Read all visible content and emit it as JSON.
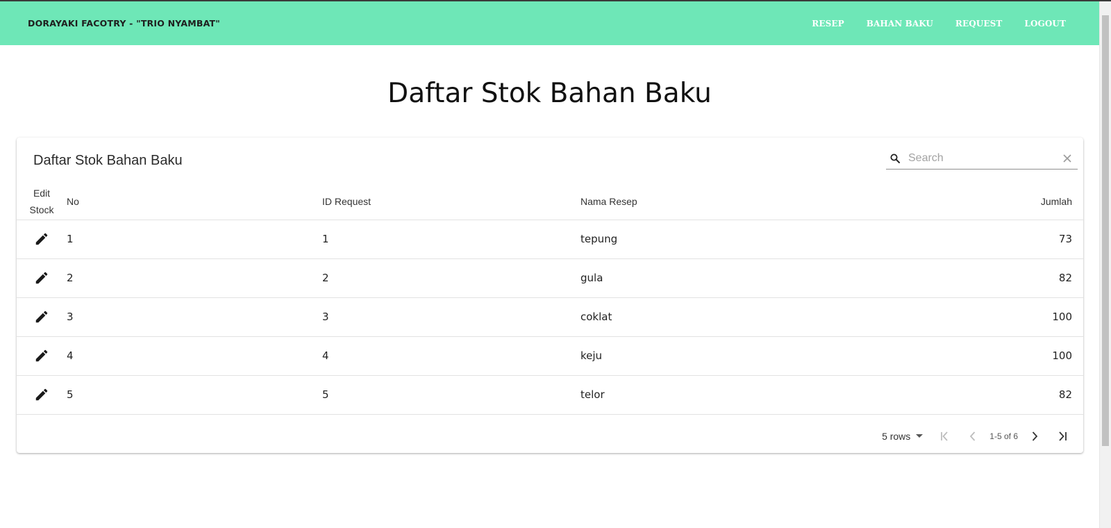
{
  "navbar": {
    "brand": "DORAYAKI FACOTRY - \"TRIO NYAMBAT\"",
    "links": [
      "RESEP",
      "BAHAN BAKU",
      "REQUEST",
      "LOGOUT"
    ]
  },
  "page_title": "Daftar Stok Bahan Baku",
  "card": {
    "title": "Daftar Stok Bahan Baku",
    "search_placeholder": "Search",
    "search_value": ""
  },
  "table": {
    "headers": {
      "edit_line1": "Edit",
      "edit_line2": "Stock",
      "no": "No",
      "id_request": "ID Request",
      "nama_resep": "Nama Resep",
      "jumlah": "Jumlah"
    },
    "rows": [
      {
        "no": "1",
        "id_request": "1",
        "nama_resep": "tepung",
        "jumlah": "73"
      },
      {
        "no": "2",
        "id_request": "2",
        "nama_resep": "gula",
        "jumlah": "82"
      },
      {
        "no": "3",
        "id_request": "3",
        "nama_resep": "coklat",
        "jumlah": "100"
      },
      {
        "no": "4",
        "id_request": "4",
        "nama_resep": "keju",
        "jumlah": "100"
      },
      {
        "no": "5",
        "id_request": "5",
        "nama_resep": "telor",
        "jumlah": "82"
      }
    ]
  },
  "pagination": {
    "rows_label": "5 rows",
    "page_info": "1-5 of 6"
  },
  "colors": {
    "navbar_bg": "#6ee7b7",
    "nav_link": "#ffffff"
  },
  "icons": [
    "search-icon",
    "close-icon",
    "edit-icon",
    "dropdown-arrow-icon",
    "first-page-icon",
    "previous-page-icon",
    "next-page-icon",
    "last-page-icon"
  ]
}
